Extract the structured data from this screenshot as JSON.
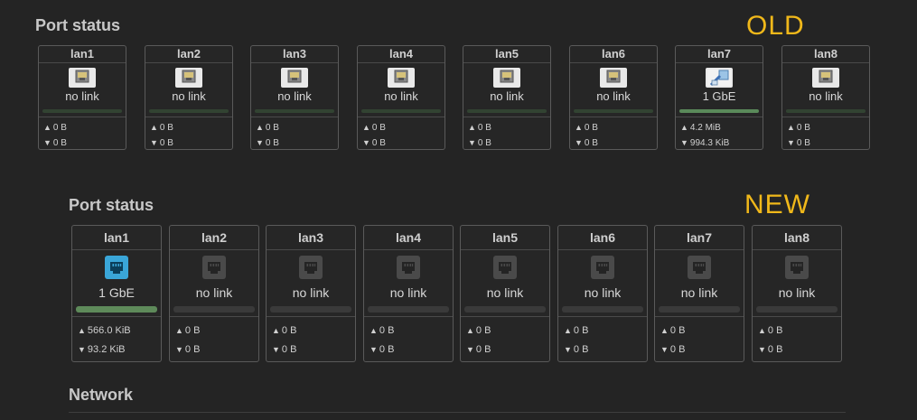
{
  "old": {
    "title": "Port status",
    "tag": "OLD",
    "ports": [
      {
        "name": "lan1",
        "status": "no link",
        "active": false,
        "tx": "0 B",
        "rx": "0 B"
      },
      {
        "name": "lan2",
        "status": "no link",
        "active": false,
        "tx": "0 B",
        "rx": "0 B"
      },
      {
        "name": "lan3",
        "status": "no link",
        "active": false,
        "tx": "0 B",
        "rx": "0 B"
      },
      {
        "name": "lan4",
        "status": "no link",
        "active": false,
        "tx": "0 B",
        "rx": "0 B"
      },
      {
        "name": "lan5",
        "status": "no link",
        "active": false,
        "tx": "0 B",
        "rx": "0 B"
      },
      {
        "name": "lan6",
        "status": "no link",
        "active": false,
        "tx": "0 B",
        "rx": "0 B"
      },
      {
        "name": "lan7",
        "status": "1 GbE",
        "active": true,
        "tx": "4.2 MiB",
        "rx": "994.3 KiB"
      },
      {
        "name": "lan8",
        "status": "no link",
        "active": false,
        "tx": "0 B",
        "rx": "0 B"
      }
    ]
  },
  "new": {
    "title": "Port status",
    "tag": "NEW",
    "ports": [
      {
        "name": "lan1",
        "status": "1 GbE",
        "active": true,
        "tx": "566.0 KiB",
        "rx": "93.2 KiB"
      },
      {
        "name": "lan2",
        "status": "no link",
        "active": false,
        "tx": "0 B",
        "rx": "0 B"
      },
      {
        "name": "lan3",
        "status": "no link",
        "active": false,
        "tx": "0 B",
        "rx": "0 B"
      },
      {
        "name": "lan4",
        "status": "no link",
        "active": false,
        "tx": "0 B",
        "rx": "0 B"
      },
      {
        "name": "lan5",
        "status": "no link",
        "active": false,
        "tx": "0 B",
        "rx": "0 B"
      },
      {
        "name": "lan6",
        "status": "no link",
        "active": false,
        "tx": "0 B",
        "rx": "0 B"
      },
      {
        "name": "lan7",
        "status": "no link",
        "active": false,
        "tx": "0 B",
        "rx": "0 B"
      },
      {
        "name": "lan8",
        "status": "no link",
        "active": false,
        "tx": "0 B",
        "rx": "0 B"
      }
    ]
  },
  "network": {
    "title": "Network"
  },
  "icons": {
    "port_icon": "ethernet-port-icon",
    "tx_icon": "upload-arrow-icon",
    "rx_icon": "download-arrow-icon"
  },
  "colors": {
    "tag": "#f0b81a",
    "active_port": "#3aa6d8",
    "active_bar": "#5e8a5a"
  }
}
